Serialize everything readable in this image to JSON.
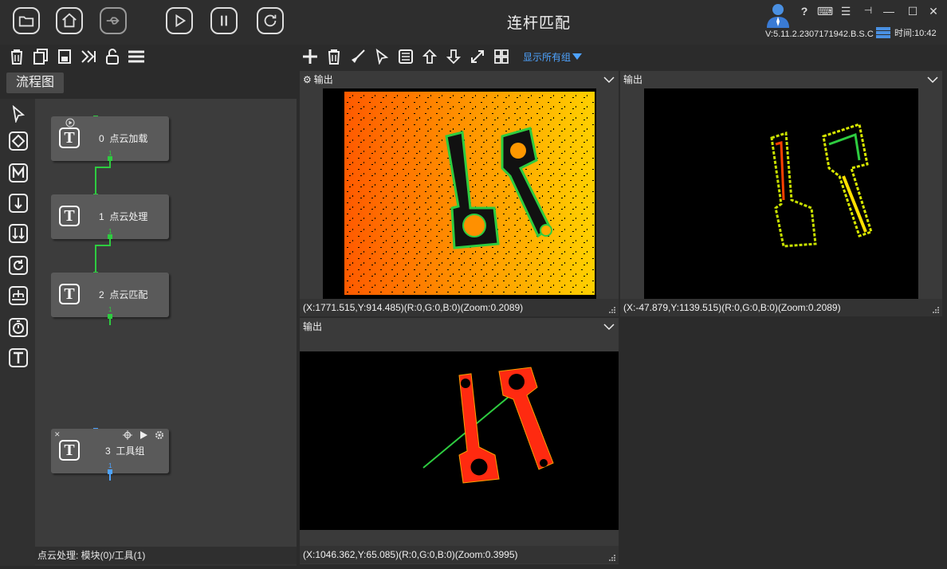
{
  "app": {
    "title": "连杆匹配",
    "version": "V:5.11.2.2307171942.B.S.C",
    "time": "时间:10:42"
  },
  "titlebar": {
    "buttons": [
      "folder-open",
      "home",
      "usb",
      "play",
      "pause",
      "refresh"
    ],
    "window_controls": [
      "?",
      "keyboard",
      "menu",
      "pin",
      "minimize",
      "maximize",
      "close"
    ]
  },
  "toolbar_left": [
    "delete-icon",
    "copy-icon",
    "save-icon",
    "step-icon",
    "unlock-icon",
    "list-icon"
  ],
  "toolbar_right": {
    "icons": [
      "add-icon",
      "delete-icon",
      "brush-icon",
      "pointer-icon",
      "calculator-icon",
      "arrow-up-icon",
      "arrow-down-icon",
      "expand-icon",
      "grid-icon"
    ],
    "show_groups": "显示所有组"
  },
  "flow": {
    "tab_label": "流程图",
    "status": "点云处理: 模块(0)/工具(1)",
    "side_tools": [
      "pointer",
      "diamond",
      "M",
      "down-arrow",
      "double-arrow",
      "loop",
      "tree",
      "timer",
      "T"
    ],
    "nodes": [
      {
        "index": "0",
        "name": "点云加载",
        "icon": "T"
      },
      {
        "index": "1",
        "name": "点云处理",
        "icon": "T"
      },
      {
        "index": "2",
        "name": "点云匹配",
        "icon": "T"
      },
      {
        "index": "3",
        "name": "工具组",
        "icon": "T"
      }
    ],
    "port_label": "1"
  },
  "views": [
    {
      "title": "输出",
      "status": "(X:1771.515,Y:914.485)(R:0,G:0,B:0)(Zoom:0.2089)"
    },
    {
      "title": "输出",
      "status": "(X:-47.879,Y:1139.515)(R:0,G:0,B:0)(Zoom:0.2089)"
    },
    {
      "title": "输出",
      "status": "(X:1046.362,Y:65.085)(R:0,G:0,B:0)(Zoom:0.3995)"
    }
  ],
  "colors": {
    "accent_green": "#2ecc40",
    "link_blue": "#4ea3ff",
    "match_red": "#ff2a10"
  }
}
